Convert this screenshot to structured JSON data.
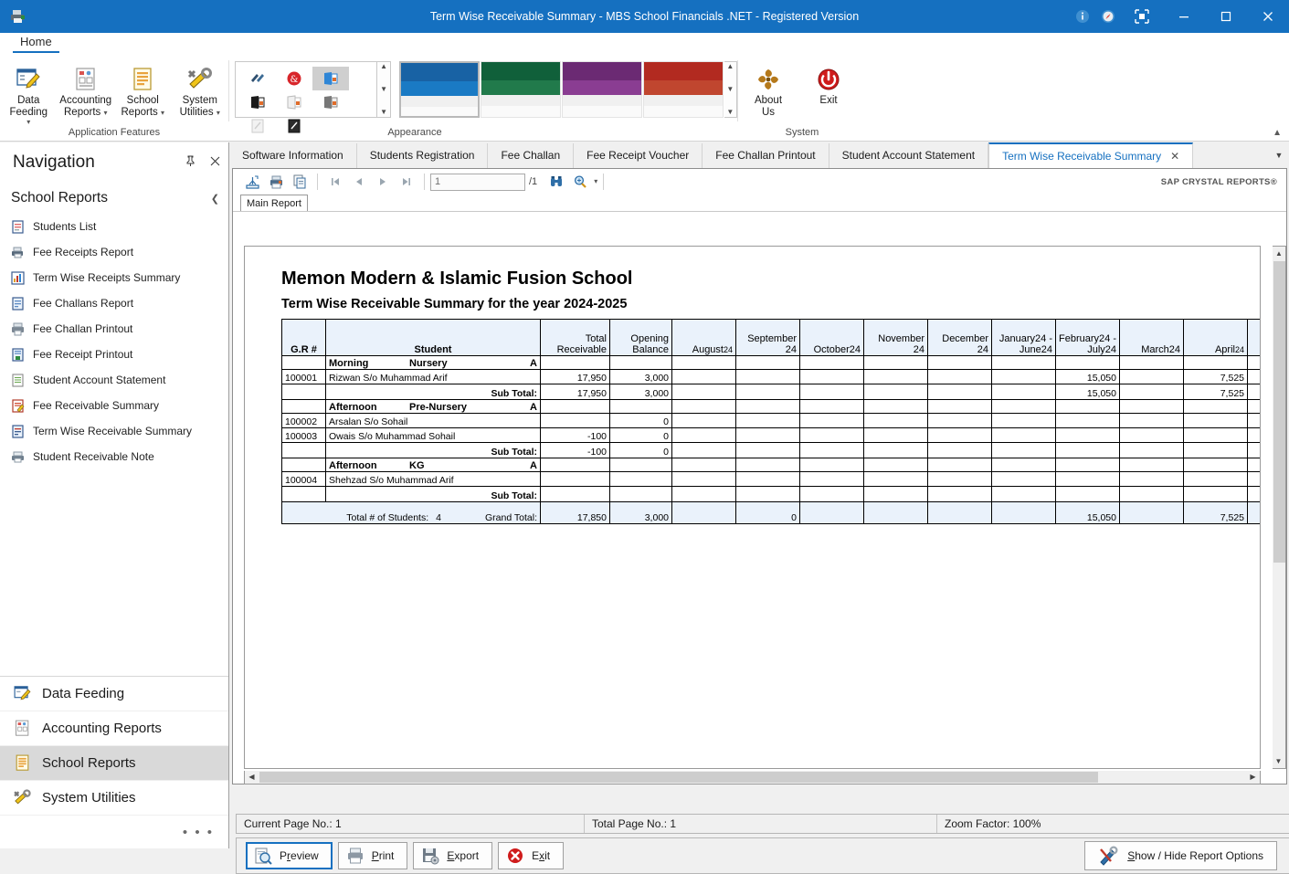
{
  "window": {
    "title": "Term Wise Receivable Summary - MBS School Financials .NET - Registered Version",
    "app_icon": "printer-icon",
    "info_icon": "info-icon",
    "compass_icon": "compass-icon",
    "restore_layout_icon": "restore-layout-icon",
    "minimize_icon": "minimize-icon",
    "maximize_icon": "maximize-icon",
    "close_icon": "close-icon",
    "accent_color": "#1570c0"
  },
  "ribbon": {
    "tabs": [
      {
        "label": "Home",
        "selected": true
      }
    ],
    "groups": [
      {
        "label": "Application Features",
        "buttons": [
          {
            "label_line1": "Data Feeding",
            "label_line2": "",
            "icon": "data-feeding-icon",
            "has_chevron": true
          },
          {
            "label_line1": "Accounting",
            "label_line2": "Reports",
            "icon": "accounting-reports-icon",
            "has_chevron": true
          },
          {
            "label_line1": "School",
            "label_line2": "Reports",
            "icon": "school-reports-icon",
            "has_chevron": true
          },
          {
            "label_line1": "System",
            "label_line2": "Utilities",
            "icon": "system-utilities-icon",
            "has_chevron": true
          }
        ]
      },
      {
        "label": "Appearance",
        "skin_icons": [
          "skin-default-icon",
          "skin-red-icon",
          "skin-blue-icon",
          "skin-black-icon",
          "skin-white-icon",
          "skin-gray-icon",
          "skin-light-icon",
          "skin-dark-icon"
        ],
        "selected_skin_index": 2,
        "themes": [
          {
            "name": "blue-theme",
            "color_top": "#1862a4",
            "color_mid": "#1a7ac4",
            "selected": true
          },
          {
            "name": "green-theme",
            "color_top": "#10603a",
            "color_mid": "#217a4b",
            "selected": false
          },
          {
            "name": "purple-theme",
            "color_top": "#6b2a73",
            "color_mid": "#8a3d92",
            "selected": false
          },
          {
            "name": "red-theme",
            "color_top": "#b22a20",
            "color_mid": "#c0462f",
            "selected": false
          }
        ]
      },
      {
        "label": "System",
        "buttons": [
          {
            "label_line1": "About",
            "label_line2": "Us",
            "icon": "about-us-icon"
          },
          {
            "label_line1": "Exit",
            "label_line2": "",
            "icon": "exit-power-icon"
          }
        ]
      }
    ],
    "collapse_icon": "chevron-up-icon"
  },
  "navigation": {
    "title": "Navigation",
    "pin_icon": "pin-icon",
    "close_icon": "close-icon",
    "section_title": "School Reports",
    "collapse_icon": "chevron-left-icon",
    "items": [
      {
        "label": "Students List",
        "icon": "students-list-icon"
      },
      {
        "label": "Fee Receipts Report",
        "icon": "fee-receipts-report-icon"
      },
      {
        "label": "Term Wise Receipts Summary",
        "icon": "term-wise-receipts-summary-icon"
      },
      {
        "label": "Fee Challans Report",
        "icon": "fee-challans-report-icon"
      },
      {
        "label": "Fee Challan Printout",
        "icon": "fee-challan-printout-icon"
      },
      {
        "label": "Fee Receipt Printout",
        "icon": "fee-receipt-printout-icon"
      },
      {
        "label": "Student Account Statement",
        "icon": "student-account-statement-icon"
      },
      {
        "label": "Fee Receivable Summary",
        "icon": "fee-receivable-summary-icon"
      },
      {
        "label": "Term Wise Receivable Summary",
        "icon": "term-wise-receivable-summary-icon"
      },
      {
        "label": "Student Receivable Note",
        "icon": "student-receivable-note-icon"
      }
    ],
    "bottom_items": [
      {
        "label": "Data Feeding",
        "icon": "data-feeding-icon",
        "selected": false
      },
      {
        "label": "Accounting Reports",
        "icon": "accounting-reports-icon",
        "selected": false
      },
      {
        "label": "School Reports",
        "icon": "school-reports-icon",
        "selected": true
      },
      {
        "label": "System Utilities",
        "icon": "system-utilities-icon",
        "selected": false
      }
    ],
    "overflow_label": "• • •"
  },
  "document_tabs": [
    {
      "label": "Software Information",
      "selected": false
    },
    {
      "label": "Students Registration",
      "selected": false
    },
    {
      "label": "Fee Challan",
      "selected": false
    },
    {
      "label": "Fee Receipt Voucher",
      "selected": false
    },
    {
      "label": "Fee Challan Printout",
      "selected": false
    },
    {
      "label": "Student Account Statement",
      "selected": false
    },
    {
      "label": "Term Wise Receivable Summary",
      "selected": true,
      "close_icon": "close-icon"
    }
  ],
  "document_tabs_more_icon": "chevron-down-icon",
  "viewer": {
    "toolbar": {
      "export_icon": "export-icon",
      "print_icon": "print-icon",
      "copy_icon": "copy-icon",
      "first_page_icon": "first-page-icon",
      "prev_page_icon": "previous-page-icon",
      "next_page_icon": "next-page-icon",
      "last_page_icon": "last-page-icon",
      "page_value": "1",
      "page_placeholder": "1",
      "page_total": "/1",
      "search_icon": "binoculars-search-icon",
      "zoom_icon": "zoom-icon",
      "zoom_dropdown_icon": "chevron-down-icon"
    },
    "branding": "SAP CRYSTAL REPORTS®",
    "report_tab": "Main Report",
    "vscroll_up_icon": "chevron-up-icon",
    "vscroll_down_icon": "chevron-down-icon",
    "hscroll_left_icon": "chevron-left-icon",
    "hscroll_right_icon": "chevron-right-icon"
  },
  "report": {
    "school_name": "Memon Modern & Islamic Fusion School",
    "report_title": "Term Wise Receivable Summary for the year 2024-2025",
    "columns": [
      {
        "key": "gr",
        "label": "G.R #",
        "align": "center"
      },
      {
        "key": "student",
        "label": "Student",
        "align": "center"
      },
      {
        "key": "total_receivable",
        "label": "Total Receivable",
        "align": "right"
      },
      {
        "key": "opening_balance",
        "label": "Opening Balance",
        "align": "right"
      },
      {
        "key": "aug24",
        "label_main": "August",
        "label_year": "24",
        "align": "right"
      },
      {
        "key": "sep24",
        "label_main": "September",
        "label_year": "24",
        "align": "right"
      },
      {
        "key": "oct24",
        "label_main": "October",
        "label_year": "24",
        "align": "right"
      },
      {
        "key": "nov24",
        "label_main": "November",
        "label_year": "24",
        "align": "right"
      },
      {
        "key": "dec24",
        "label_main": "December",
        "label_year": "24",
        "align": "right"
      },
      {
        "key": "jan24jun24",
        "label_main": "January24 - June24",
        "label_year": "",
        "align": "right"
      },
      {
        "key": "feb24jul24",
        "label_main": "February24 - July24",
        "label_year": "",
        "align": "right"
      },
      {
        "key": "mar24",
        "label_main": "March24",
        "label_year": "",
        "align": "right"
      },
      {
        "key": "apr24",
        "label_main": "April",
        "label_year": "24",
        "align": "right"
      },
      {
        "key": "extra",
        "label_main": "",
        "label_year": "",
        "align": "right"
      }
    ],
    "groups": [
      {
        "shift": "Morning",
        "class": "Nursery",
        "section": "A",
        "students": [
          {
            "gr": "100001",
            "name": "Rizwan S/o Muhammad Arif",
            "total_receivable": "17,950",
            "opening_balance": "3,000",
            "aug24": "",
            "sep24": "",
            "oct24": "",
            "nov24": "",
            "dec24": "",
            "jan24jun24": "",
            "feb24jul24": "15,050",
            "mar24": "",
            "apr24": "7,525",
            "extra": ""
          }
        ],
        "subtotal": {
          "label": "Sub Total:",
          "total_receivable": "17,950",
          "opening_balance": "3,000",
          "aug24": "",
          "sep24": "",
          "oct24": "",
          "nov24": "",
          "dec24": "",
          "jan24jun24": "",
          "feb24jul24": "15,050",
          "mar24": "",
          "apr24": "7,525",
          "extra": ""
        }
      },
      {
        "shift": "Afternoon",
        "class": "Pre-Nursery",
        "section": "A",
        "students": [
          {
            "gr": "100002",
            "name": "Arsalan S/o Sohail",
            "total_receivable": "",
            "opening_balance": "0",
            "aug24": "",
            "sep24": "",
            "oct24": "",
            "nov24": "",
            "dec24": "",
            "jan24jun24": "",
            "feb24jul24": "",
            "mar24": "",
            "apr24": "",
            "extra": ""
          },
          {
            "gr": "100003",
            "name": "Owais S/o Muhammad Sohail",
            "total_receivable": "-100",
            "opening_balance": "0",
            "aug24": "",
            "sep24": "",
            "oct24": "",
            "nov24": "",
            "dec24": "",
            "jan24jun24": "",
            "feb24jul24": "",
            "mar24": "",
            "apr24": "",
            "extra": ""
          }
        ],
        "subtotal": {
          "label": "Sub Total:",
          "total_receivable": "-100",
          "opening_balance": "0",
          "aug24": "",
          "sep24": "",
          "oct24": "",
          "nov24": "",
          "dec24": "",
          "jan24jun24": "",
          "feb24jul24": "",
          "mar24": "",
          "apr24": "",
          "extra": ""
        }
      },
      {
        "shift": "Afternoon",
        "class": "KG",
        "section": "A",
        "students": [
          {
            "gr": "100004",
            "name": "Shehzad S/o Muhammad Arif",
            "total_receivable": "",
            "opening_balance": "",
            "aug24": "",
            "sep24": "",
            "oct24": "",
            "nov24": "",
            "dec24": "",
            "jan24jun24": "",
            "feb24jul24": "",
            "mar24": "",
            "apr24": "",
            "extra": ""
          }
        ],
        "subtotal": {
          "label": "Sub Total:",
          "total_receivable": "",
          "opening_balance": "",
          "aug24": "",
          "sep24": "",
          "oct24": "",
          "nov24": "",
          "dec24": "",
          "jan24jun24": "",
          "feb24jul24": "",
          "mar24": "",
          "apr24": "",
          "extra": ""
        }
      }
    ],
    "grand_total": {
      "students_label": "Total # of Students:",
      "students_count": "4",
      "label": "Grand Total:",
      "total_receivable": "17,850",
      "opening_balance": "3,000",
      "aug24": "",
      "sep24": "0",
      "oct24": "",
      "nov24": "",
      "dec24": "",
      "jan24jun24": "",
      "feb24jul24": "15,050",
      "mar24": "",
      "apr24": "7,525",
      "extra": ""
    }
  },
  "status": {
    "current_page": "Current Page No.: 1",
    "total_page": "Total Page No.: 1",
    "zoom_factor": "Zoom Factor: 100%"
  },
  "bottom_buttons": [
    {
      "label": "Preview",
      "icon": "preview-icon",
      "focused": true,
      "accesskey_index": 3
    },
    {
      "label": "Print",
      "icon": "print-icon",
      "focused": false,
      "accesskey_index": 0
    },
    {
      "label": "Export",
      "icon": "export-disk-icon",
      "focused": false,
      "accesskey_index": 0
    },
    {
      "label": "Exit",
      "icon": "exit-red-icon",
      "focused": false,
      "accesskey_index": 1
    }
  ],
  "show_hide_button": {
    "label": "Show / Hide Report Options",
    "icon": "report-options-icon"
  }
}
